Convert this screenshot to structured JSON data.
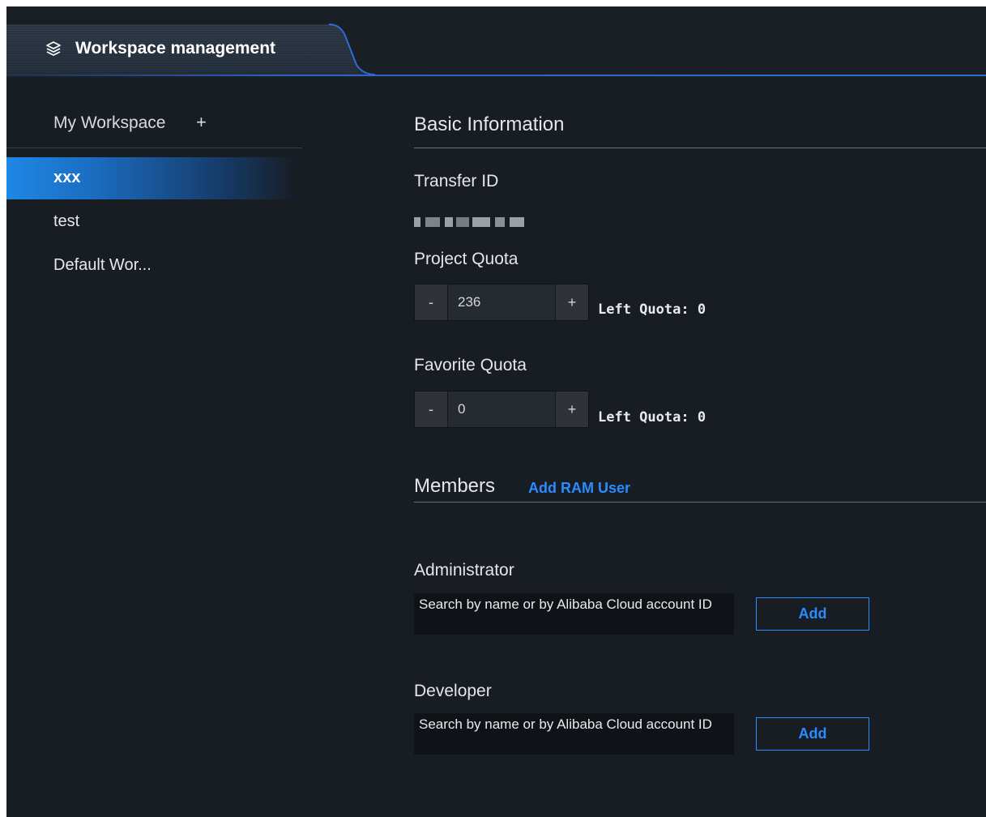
{
  "tabs": [
    {
      "label": "Workspace management",
      "icon": "layers-icon",
      "active": true
    }
  ],
  "sidebar": {
    "header": "My Workspace",
    "add_symbol": "+",
    "items": [
      {
        "label": "xxx",
        "active": true
      },
      {
        "label": "test",
        "active": false
      },
      {
        "label": "Default Wor...",
        "active": false
      }
    ]
  },
  "basic_info": {
    "title": "Basic Information",
    "transfer_id_label": "Transfer ID",
    "project_quota": {
      "label": "Project Quota",
      "minus": "-",
      "plus": "+",
      "value": "236",
      "left_quota": "Left Quota: 0"
    },
    "favorite_quota": {
      "label": "Favorite Quota",
      "minus": "-",
      "plus": "+",
      "value": "0",
      "left_quota": "Left Quota: 0"
    }
  },
  "members": {
    "title": "Members",
    "add_ram_user": "Add RAM User",
    "administrator": {
      "label": "Administrator",
      "placeholder": "Search by name or by Alibaba Cloud account ID",
      "add_label": "Add"
    },
    "developer": {
      "label": "Developer",
      "placeholder": "Search by name or by Alibaba Cloud account ID",
      "add_label": "Add"
    }
  },
  "colors": {
    "background": "#181c23",
    "accent": "#2b8cff",
    "active_item": "#1e88e5",
    "text": "#e4e6ea"
  }
}
